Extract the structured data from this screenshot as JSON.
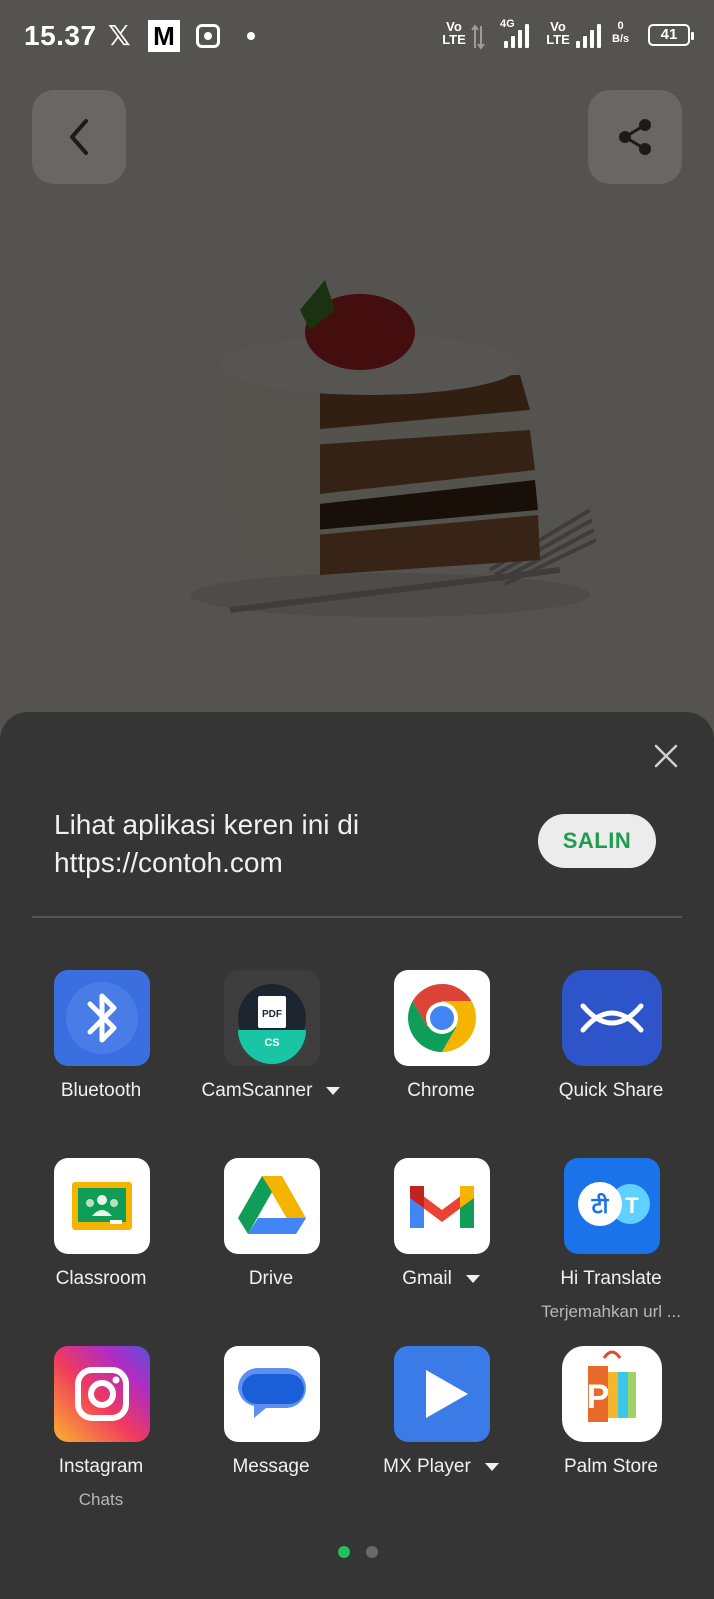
{
  "status_bar": {
    "time": "15.37",
    "x_glyph": "𝕏",
    "m_glyph": "M",
    "volte_1": "Vo LTE",
    "volte_2": "Vo LTE",
    "network_4g": "4G",
    "net_speed_value": "0",
    "net_speed_unit": "B/s",
    "battery": "41"
  },
  "background_app": {
    "back_icon": "chevron-left-icon",
    "share_icon": "share-icon",
    "image": "cake-slice"
  },
  "share_sheet": {
    "message_line1": "Lihat aplikasi keren ini di",
    "message_line2": "https://contoh.com",
    "copy_label": "SALIN",
    "close_icon": "close-icon",
    "apps": [
      {
        "label": "Bluetooth",
        "icon": "bluetooth-icon"
      },
      {
        "label": "CamScanner",
        "icon": "camscanner-icon",
        "has_dropdown": true,
        "icon_text_top": "PDF",
        "icon_text_bottom": "CS"
      },
      {
        "label": "Chrome",
        "icon": "chrome-icon"
      },
      {
        "label": "Quick Share",
        "icon": "quick-share-icon"
      },
      {
        "label": "Classroom",
        "icon": "classroom-icon"
      },
      {
        "label": "Drive",
        "icon": "drive-icon"
      },
      {
        "label": "Gmail",
        "icon": "gmail-icon",
        "has_dropdown": true
      },
      {
        "label": "Hi Translate",
        "sublabel": "Terjemahkan url ...",
        "icon": "hi-translate-icon",
        "icon_text_left": "टी",
        "icon_text_right": "T"
      },
      {
        "label": "Instagram",
        "sublabel": "Chats",
        "icon": "instagram-icon"
      },
      {
        "label": "Message",
        "icon": "message-icon"
      },
      {
        "label": "MX Player",
        "icon": "mx-player-icon",
        "has_dropdown": true
      },
      {
        "label": "Palm Store",
        "icon": "palm-store-icon",
        "icon_text": "P"
      }
    ],
    "page_indicator": {
      "pages": 2,
      "active": 1
    }
  },
  "colors": {
    "sheet_bg": "#353535",
    "copy_text": "#1e9e4d",
    "active_dot": "#21c25e",
    "inactive_dot": "#6a6a6a"
  }
}
